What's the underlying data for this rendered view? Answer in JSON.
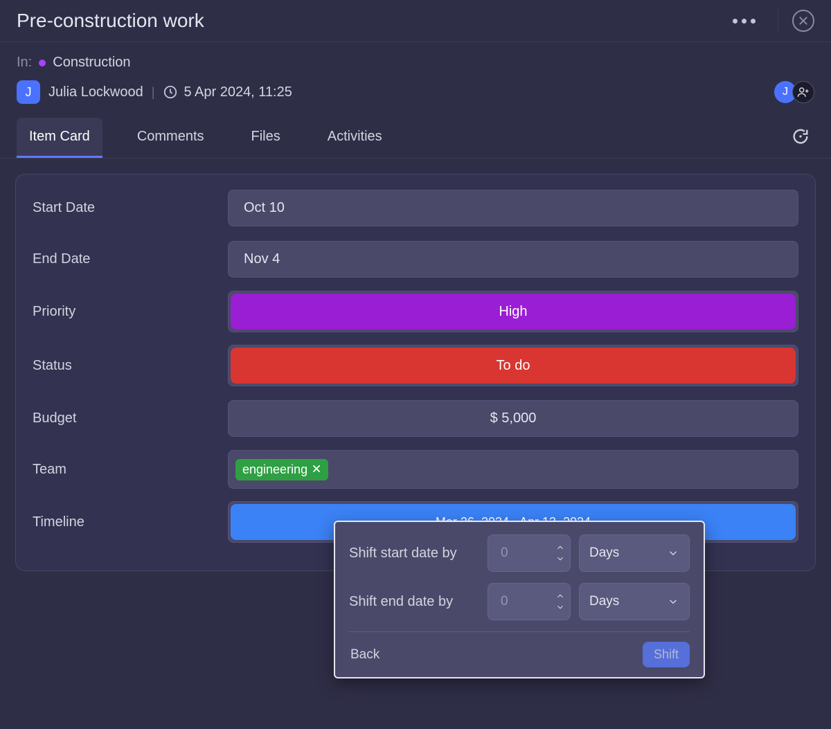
{
  "header": {
    "title": "Pre-construction work"
  },
  "meta": {
    "in_label": "In:",
    "board": "Construction",
    "author_initial": "J",
    "author_name": "Julia Lockwood",
    "timestamp": "5 Apr 2024, 11:25",
    "assignee_initial": "J"
  },
  "tabs": {
    "item_card": "Item  Card",
    "comments": "Comments",
    "files": "Files",
    "activities": "Activities"
  },
  "fields": {
    "start_date": {
      "label": "Start Date",
      "value": "Oct 10"
    },
    "end_date": {
      "label": "End Date",
      "value": "Nov 4"
    },
    "priority": {
      "label": "Priority",
      "value": "High"
    },
    "status": {
      "label": "Status",
      "value": "To do"
    },
    "budget": {
      "label": "Budget",
      "value": "$ 5,000"
    },
    "team": {
      "label": "Team",
      "tag": "engineering"
    },
    "timeline": {
      "label": "Timeline",
      "value": "Mar 26, 2024 - Apr 13, 2024"
    }
  },
  "popover": {
    "shift_start_label": "Shift start date by",
    "shift_end_label": "Shift end date by",
    "start_value": "",
    "end_value": "",
    "start_placeholder": "0",
    "end_placeholder": "0",
    "unit_start": "Days",
    "unit_end": "Days",
    "back": "Back",
    "shift": "Shift"
  },
  "colors": {
    "priority_bg": "#9a1ed4",
    "status_bg": "#d93531",
    "timeline_bg": "#3b82f6",
    "team_tag_bg": "#2ea043",
    "accent": "#5b7cff"
  }
}
